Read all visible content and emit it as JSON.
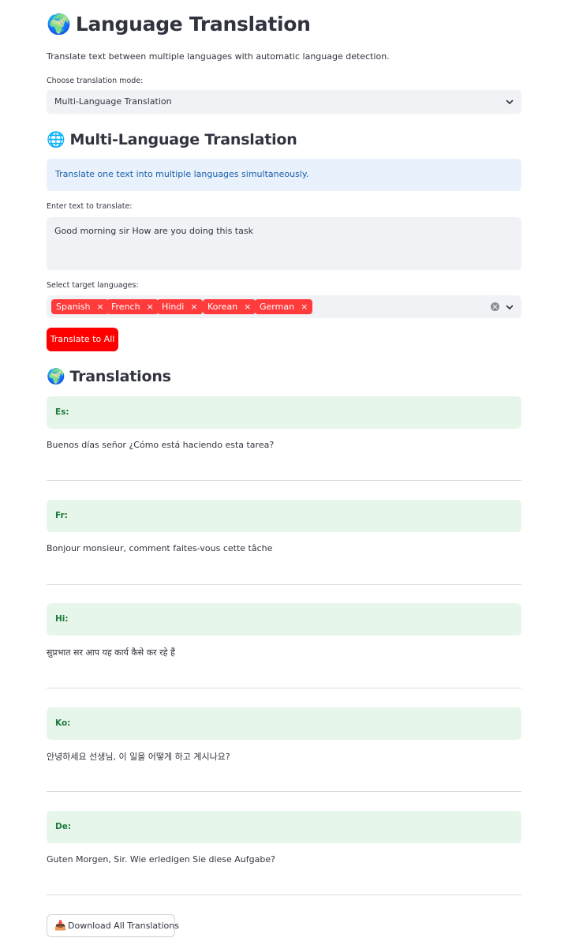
{
  "header": {
    "title_icon": "🌍",
    "title": "Language Translation",
    "subtitle": "Translate text between multiple languages with automatic language detection."
  },
  "mode": {
    "label": "Choose translation mode:",
    "value": "Multi-Language Translation"
  },
  "section": {
    "icon": "🌐",
    "title": "Multi-Language Translation",
    "info": "Translate one text into multiple languages simultaneously."
  },
  "input": {
    "label": "Enter text to translate:",
    "value": "Good morning sir How are you doing this task"
  },
  "targets": {
    "label": "Select target languages:",
    "tags": [
      "Spanish",
      "French",
      "Hindi",
      "Korean",
      "German"
    ],
    "remove_glyph": "×"
  },
  "actions": {
    "translate_label": "Translate to All",
    "download_icon": "📥",
    "download_label": "Download All Translations"
  },
  "results": {
    "icon": "🌍",
    "title": "Translations",
    "items": [
      {
        "code": "Es:",
        "text": "Buenos días señor ¿Cómo está haciendo esta tarea?"
      },
      {
        "code": "Fr:",
        "text": "Bonjour monsieur, comment faites-vous cette tâche"
      },
      {
        "code": "Hi:",
        "text": "सुप्रभात सर आप यह कार्य कैसे कर रहे हैं"
      },
      {
        "code": "Ko:",
        "text": "안녕하세요 선생님, 이 일을 어떻게 하고 계시나요?"
      },
      {
        "code": "De:",
        "text": "Guten Morgen, Sir. Wie erledigen Sie diese Aufgabe?"
      }
    ]
  },
  "colors": {
    "accent": "#ff0000",
    "tag": "#ff3b3b",
    "info_bg": "#e8f1fc",
    "success_bg": "#e6f6ea",
    "success_text": "#1d7a3a"
  }
}
